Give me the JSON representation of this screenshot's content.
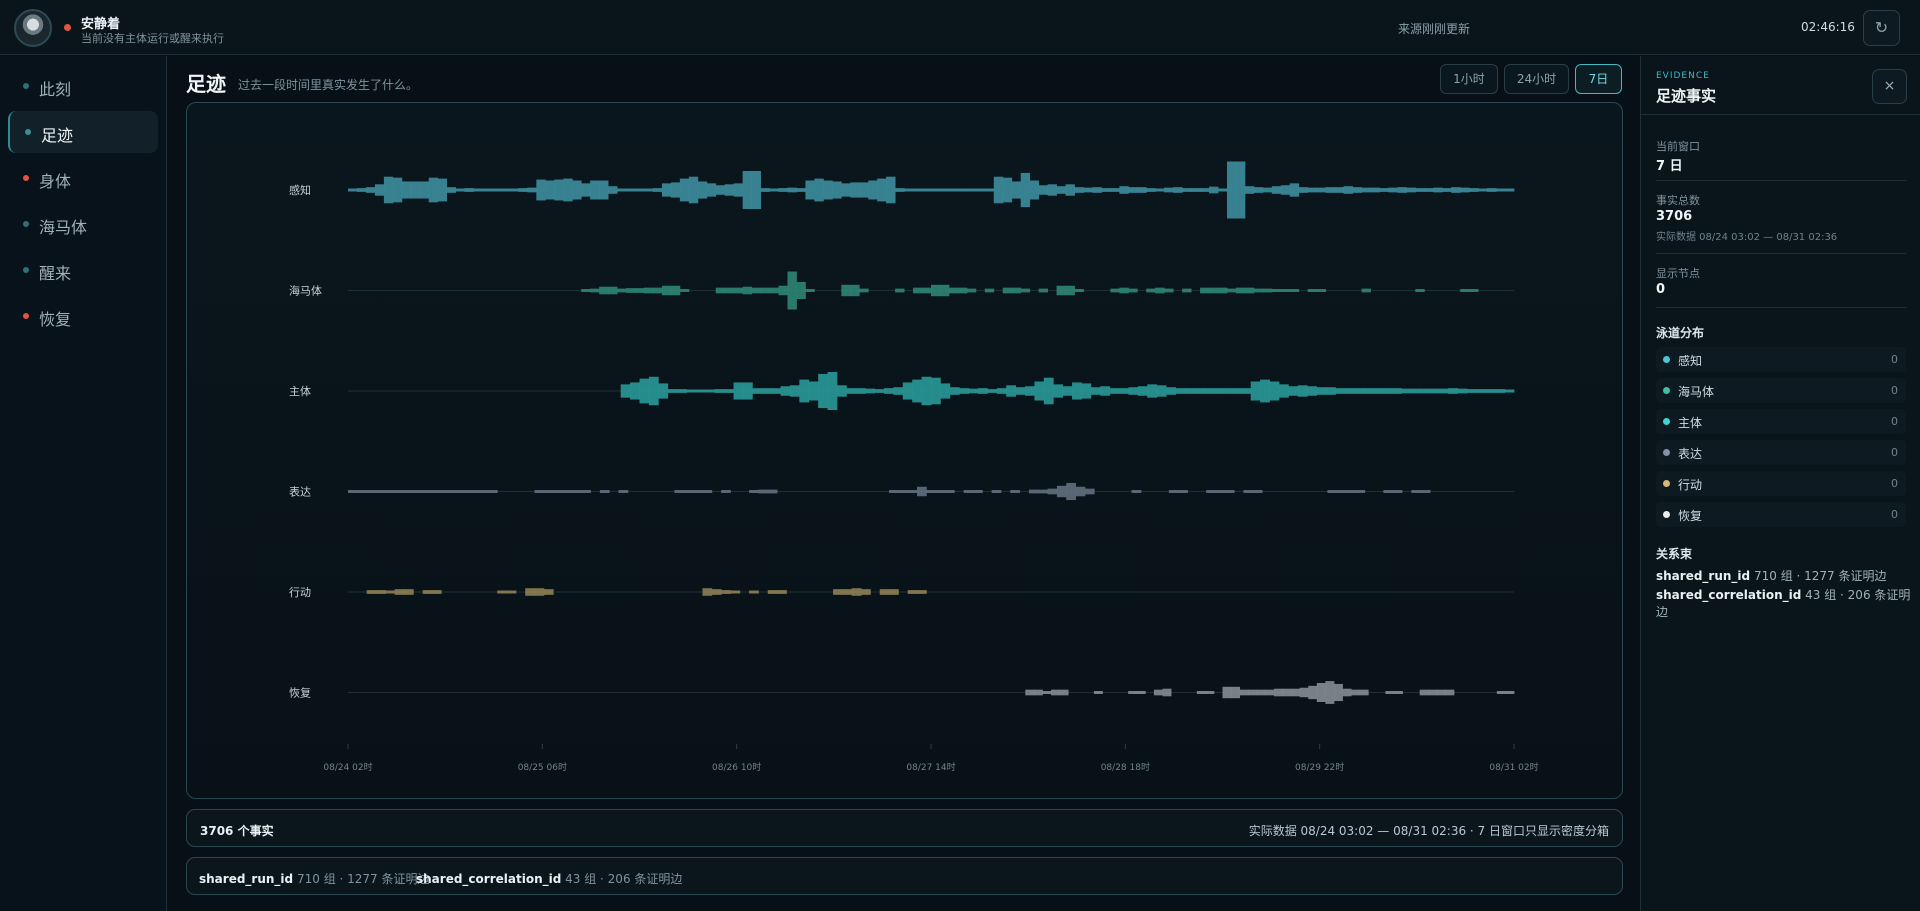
{
  "topbar": {
    "name": "安静着",
    "subtitle": "当前没有主体运行或醒来执行",
    "center_text": "来源刚刚更新",
    "time": "02:46:16",
    "refresh_icon": "↻"
  },
  "sidebar": {
    "items": [
      {
        "label": "此刻",
        "dot_color": "#2f6f78",
        "active": false
      },
      {
        "label": "足迹",
        "dot_color": "#3a8e98",
        "active": true
      },
      {
        "label": "身体",
        "dot_color": "#e0553f",
        "active": false
      },
      {
        "label": "海马体",
        "dot_color": "#2f6f78",
        "active": false
      },
      {
        "label": "醒来",
        "dot_color": "#2f6f78",
        "active": false
      },
      {
        "label": "恢复",
        "dot_color": "#e0553f",
        "active": false
      }
    ]
  },
  "main": {
    "title": "足迹",
    "subtitle": "过去一段时间里真实发生了什么。",
    "ranges": [
      "1小时",
      "24小时",
      "7日"
    ],
    "active_range": "7日"
  },
  "chart_data": {
    "type": "area",
    "lanes": [
      {
        "name": "感知",
        "color": "#3c8d9e",
        "values": [
          2,
          4,
          6,
          12,
          28,
          26,
          18,
          18,
          18,
          26,
          24,
          6,
          3,
          4,
          3,
          3,
          3,
          2,
          3,
          4,
          5,
          22,
          20,
          22,
          24,
          20,
          14,
          20,
          20,
          8,
          3,
          2,
          2,
          3,
          4,
          14,
          16,
          24,
          28,
          18,
          14,
          10,
          12,
          14,
          40,
          40,
          4,
          3,
          4,
          5,
          4,
          20,
          24,
          20,
          18,
          14,
          16,
          16,
          20,
          24,
          28,
          4,
          3,
          3,
          3,
          3,
          3,
          3,
          3,
          3,
          3,
          3,
          28,
          26,
          18,
          36,
          20,
          10,
          12,
          8,
          12,
          6,
          5,
          6,
          4,
          4,
          8,
          6,
          6,
          4,
          3,
          5,
          6,
          4,
          4,
          4,
          7,
          3,
          60,
          60,
          8,
          6,
          5,
          8,
          10,
          14,
          6,
          5,
          5,
          6,
          6,
          8,
          6,
          5,
          5,
          4,
          5,
          6,
          5,
          4,
          4,
          5,
          4,
          6,
          5,
          4,
          3,
          4,
          3,
          2
        ]
      },
      {
        "name": "海马体",
        "color": "#2f8576",
        "values": [
          0,
          0,
          0,
          0,
          0,
          0,
          0,
          0,
          0,
          0,
          0,
          0,
          0,
          0,
          0,
          0,
          0,
          0,
          0,
          0,
          0,
          0,
          0,
          0,
          0,
          0,
          1,
          4,
          8,
          8,
          4,
          5,
          5,
          6,
          6,
          10,
          10,
          1,
          0,
          0,
          0,
          6,
          6,
          6,
          8,
          6,
          6,
          6,
          10,
          40,
          18,
          2,
          0,
          0,
          0,
          12,
          12,
          4,
          0,
          0,
          0,
          4,
          0,
          6,
          6,
          12,
          12,
          6,
          6,
          4,
          0,
          4,
          0,
          6,
          6,
          4,
          0,
          4,
          0,
          10,
          10,
          2,
          0,
          0,
          0,
          4,
          6,
          4,
          0,
          4,
          6,
          4,
          0,
          4,
          0,
          6,
          6,
          6,
          4,
          6,
          6,
          4,
          4,
          2,
          2,
          2,
          0,
          2,
          2,
          0,
          0,
          0,
          0,
          4,
          0,
          0,
          0,
          0,
          0,
          2,
          0,
          0,
          0,
          0,
          2,
          2,
          0,
          0,
          0,
          0
        ]
      },
      {
        "name": "主体",
        "color": "#2a9898",
        "values": [
          0,
          0,
          0,
          0,
          0,
          0,
          0,
          0,
          0,
          0,
          0,
          0,
          0,
          0,
          0,
          0,
          0,
          0,
          0,
          0,
          0,
          0,
          0,
          0,
          0,
          0,
          0,
          0,
          0,
          14,
          18,
          26,
          30,
          16,
          4,
          4,
          3,
          3,
          3,
          4,
          4,
          18,
          18,
          6,
          6,
          6,
          10,
          12,
          24,
          20,
          36,
          40,
          12,
          6,
          6,
          5,
          4,
          6,
          8,
          18,
          24,
          30,
          28,
          16,
          8,
          6,
          5,
          6,
          4,
          6,
          12,
          8,
          10,
          20,
          28,
          14,
          10,
          18,
          16,
          8,
          10,
          6,
          6,
          8,
          10,
          14,
          12,
          8,
          6,
          6,
          6,
          6,
          6,
          6,
          6,
          6,
          20,
          24,
          20,
          14,
          10,
          12,
          10,
          8,
          8,
          6,
          6,
          6,
          6,
          6,
          6,
          6,
          5,
          5,
          5,
          5,
          5,
          6,
          5,
          4,
          4,
          4,
          4,
          3
        ]
      },
      {
        "name": "表达",
        "color": "#626f80",
        "values": [
          1,
          1,
          1,
          2,
          2,
          3,
          3,
          3,
          2,
          2,
          1,
          2,
          2,
          2,
          1,
          1,
          0,
          0,
          0,
          0,
          1,
          2,
          2,
          2,
          3,
          2,
          0,
          2,
          0,
          2,
          0,
          0,
          0,
          0,
          0,
          3,
          3,
          3,
          3,
          0,
          2,
          0,
          0,
          2,
          4,
          4,
          0,
          0,
          0,
          0,
          0,
          0,
          0,
          0,
          0,
          0,
          0,
          0,
          3,
          3,
          3,
          10,
          3,
          3,
          3,
          0,
          2,
          2,
          0,
          2,
          0,
          2,
          0,
          4,
          4,
          6,
          12,
          18,
          10,
          6,
          0,
          0,
          0,
          0,
          2,
          0,
          0,
          0,
          2,
          2,
          0,
          0,
          3,
          3,
          3,
          0,
          2,
          2,
          0,
          0,
          0,
          0,
          0,
          0,
          0,
          3,
          3,
          3,
          3,
          0,
          0,
          2,
          2,
          0,
          2,
          2,
          0,
          0,
          0,
          0,
          0,
          0,
          0,
          0,
          0
        ]
      },
      {
        "name": "行动",
        "color": "#8e7f55",
        "values": [
          0,
          0,
          4,
          4,
          2,
          6,
          6,
          0,
          4,
          4,
          0,
          0,
          0,
          0,
          0,
          0,
          2,
          2,
          0,
          8,
          8,
          6,
          0,
          0,
          0,
          0,
          0,
          0,
          0,
          0,
          0,
          0,
          0,
          0,
          0,
          0,
          0,
          0,
          8,
          6,
          4,
          2,
          0,
          2,
          0,
          4,
          4,
          0,
          0,
          0,
          0,
          0,
          6,
          6,
          8,
          6,
          0,
          6,
          6,
          0,
          4,
          4,
          0,
          0,
          0,
          0,
          0,
          0,
          0,
          0,
          0,
          0,
          0,
          0,
          0,
          0,
          0,
          0,
          0,
          0,
          0,
          0,
          0,
          0,
          0,
          0,
          0,
          0,
          0,
          0,
          0,
          0,
          0,
          0,
          0,
          0,
          0,
          0,
          0,
          0,
          0,
          0,
          0,
          0,
          0,
          0,
          0,
          0,
          0,
          0,
          0,
          0,
          0,
          0,
          0,
          0,
          0,
          0,
          0,
          0,
          0,
          0,
          0,
          0,
          0
        ]
      },
      {
        "name": "恢复",
        "color": "#848c94",
        "values": [
          0,
          0,
          0,
          0,
          0,
          0,
          0,
          0,
          0,
          0,
          0,
          0,
          0,
          0,
          0,
          0,
          0,
          0,
          0,
          0,
          0,
          0,
          0,
          0,
          0,
          0,
          0,
          0,
          0,
          0,
          0,
          0,
          0,
          0,
          0,
          0,
          0,
          0,
          0,
          0,
          0,
          0,
          0,
          0,
          0,
          0,
          0,
          0,
          0,
          0,
          0,
          0,
          0,
          0,
          0,
          0,
          0,
          0,
          0,
          0,
          0,
          0,
          0,
          0,
          0,
          0,
          0,
          0,
          0,
          0,
          0,
          0,
          0,
          0,
          0,
          0,
          0,
          0,
          0,
          6,
          6,
          2,
          6,
          6,
          0,
          0,
          0,
          2,
          0,
          0,
          0,
          2,
          2,
          0,
          6,
          8,
          0,
          0,
          0,
          2,
          2,
          0,
          12,
          12,
          6,
          6,
          6,
          6,
          8,
          8,
          8,
          10,
          14,
          20,
          24,
          18,
          8,
          6,
          6,
          0,
          0,
          2,
          2,
          0,
          0,
          6,
          6,
          6,
          6,
          0,
          0,
          0,
          0,
          0,
          2,
          2
        ]
      }
    ],
    "x_ticks": [
      "08/24 02时",
      "08/25 06时",
      "08/26 10时",
      "08/27 14时",
      "08/28 18时",
      "08/29 22时",
      "08/31 02时"
    ]
  },
  "summary": {
    "count": "3706 个事实",
    "right": "实际数据 08/24 03:02 — 08/31 02:36 · 7 日窗口只显示密度分箱"
  },
  "relations": [
    {
      "key": "shared_run_id",
      "value": "710 组 · 1277 条证明边"
    },
    {
      "key": "shared_correlation_id",
      "value": "43 组 · 206 条证明边"
    }
  ],
  "panel": {
    "eyebrow": "EVIDENCE",
    "title": "足迹事实",
    "close_icon": "×",
    "window_label": "当前窗口",
    "window_value": "7 日",
    "total_label": "事实总数",
    "total_value": "3706",
    "total_note": "实际数据 08/24 03:02 — 08/31 02:36",
    "nodes_label": "显示节点",
    "nodes_value": "0",
    "lanes_title": "泳道分布",
    "lanes": [
      {
        "name": "感知",
        "count": "0",
        "color": "#4ec3d6"
      },
      {
        "name": "海马体",
        "count": "0",
        "color": "#3fbf9f"
      },
      {
        "name": "主体",
        "count": "0",
        "color": "#3fd4d4"
      },
      {
        "name": "表达",
        "count": "0",
        "color": "#8790a6"
      },
      {
        "name": "行动",
        "count": "0",
        "color": "#d8b870"
      },
      {
        "name": "恢复",
        "count": "0",
        "color": "#e8ecef"
      }
    ],
    "relations_title": "关系束",
    "relations": [
      {
        "key": "shared_run_id",
        "value": "710 组 · 1277 条证明边"
      },
      {
        "key": "shared_correlation_id",
        "value": "43 组 · 206 条证明边"
      }
    ]
  }
}
